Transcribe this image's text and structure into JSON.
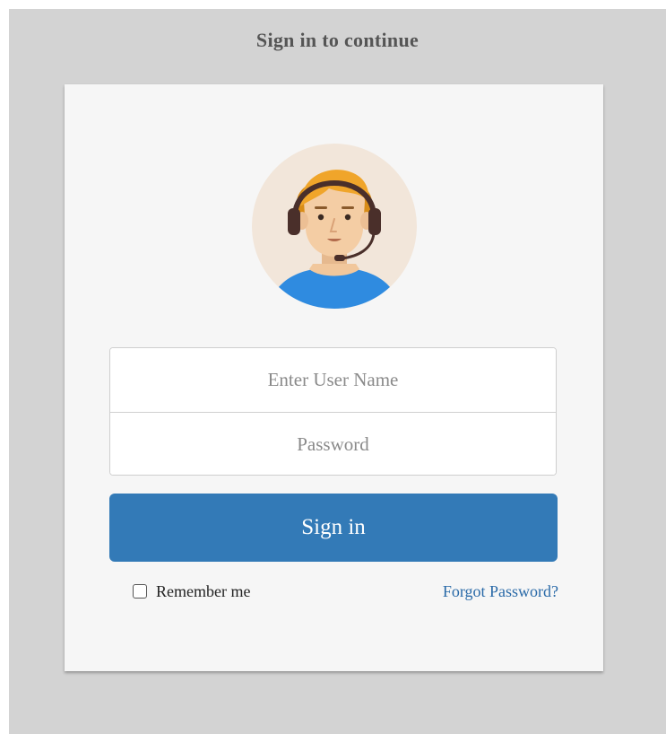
{
  "page": {
    "heading": "Sign in to continue"
  },
  "avatar": {
    "icon": "support-agent-avatar-icon"
  },
  "form": {
    "username_placeholder": "Enter User Name",
    "password_placeholder": "Password",
    "username_value": "",
    "password_value": "",
    "signin_label": "Sign in",
    "remember_label": "Remember me",
    "remember_checked": false,
    "forgot_label": "Forgot Password?"
  },
  "colors": {
    "page_background": "#d3d3d3",
    "card_background": "#f6f6f6",
    "primary_button": "#337ab7",
    "link": "#2a6aa8"
  }
}
